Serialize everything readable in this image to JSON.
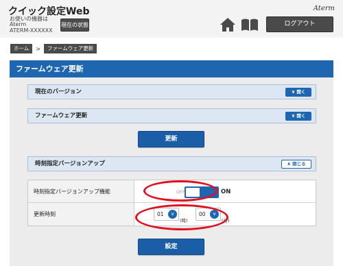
{
  "header": {
    "app_title": "クイック設定Web",
    "device_caption": "お使いの機器は",
    "device_model": "Aterm",
    "device_id": "ATERM-XXXXXX",
    "status_button": "現在の状態",
    "brand_logo": "Aterm",
    "logout_button": "ログアウト"
  },
  "breadcrumb": [
    "ホーム",
    ">",
    "ファームウェア更新"
  ],
  "page_title": "ファームウェア更新",
  "sections": {
    "current_version": {
      "label": "現在のバージョン",
      "toggle": "開く",
      "toggle_icon": "chevron-down-icon"
    },
    "firmware_update": {
      "label": "ファームウェア更新",
      "toggle": "開く",
      "toggle_icon": "chevron-down-icon"
    },
    "scheduled_update": {
      "label": "時刻指定バージョンアップ",
      "toggle": "閉じる",
      "toggle_icon": "chevron-up-icon"
    }
  },
  "buttons": {
    "update": "更新",
    "apply": "設定"
  },
  "scheduled_settings": {
    "function_label": "時刻指定バージョンアップ機能",
    "switch_off": "OFF",
    "switch_on": "ON",
    "switch_state": "on",
    "time_label": "更新時刻",
    "hour_value": "01",
    "hour_unit": "(時)",
    "minute_value": "00",
    "minute_unit": "(分)"
  },
  "colors": {
    "accent": "#1f66b1",
    "highlight": "#e0101e",
    "header_bg": "#f3f3f3"
  }
}
